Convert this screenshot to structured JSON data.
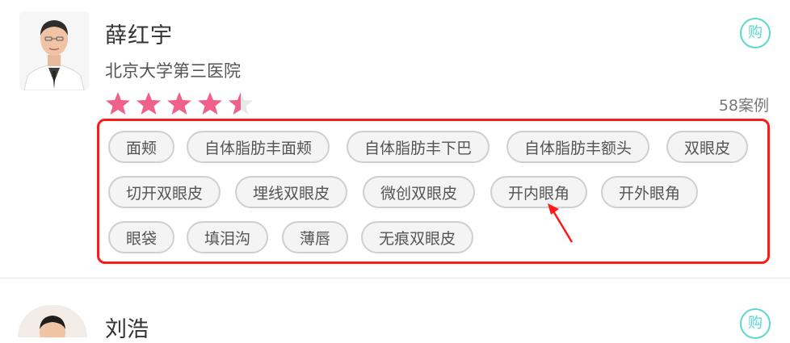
{
  "doctor1": {
    "name": "薛红宇",
    "hospital": "北京大学第三医院",
    "rating": 4.5,
    "rating_max": 5,
    "cases": "58案例",
    "buy_label": "购",
    "tags": [
      "面颊",
      "自体脂肪丰面颊",
      "自体脂肪丰下巴",
      "自体脂肪丰额头",
      "双眼皮",
      "切开双眼皮",
      "埋线双眼皮",
      "微创双眼皮",
      "开内眼角",
      "开外眼角",
      "眼袋",
      "填泪沟",
      "薄唇",
      "无痕双眼皮"
    ]
  },
  "doctor2": {
    "name": "刘浩",
    "buy_label": "购"
  },
  "colors": {
    "star": "#f0608a",
    "star_empty": "#e5e5e5",
    "highlight": "#ff1a1a",
    "accent": "#5cd6cf"
  }
}
